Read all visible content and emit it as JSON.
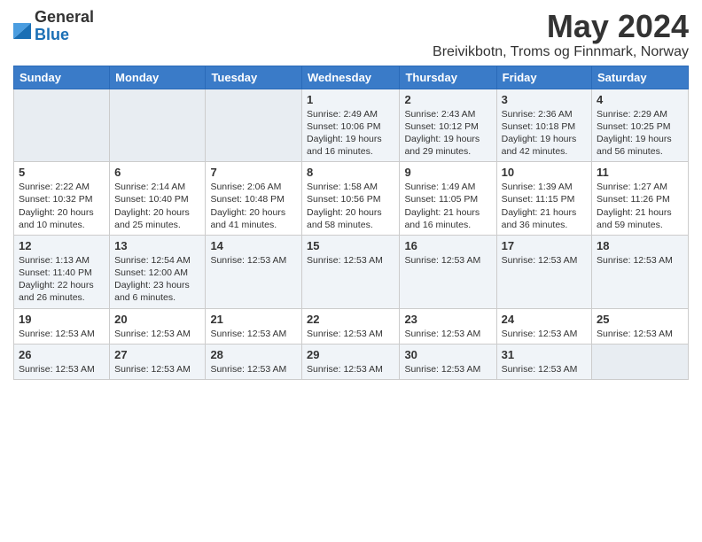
{
  "header": {
    "logo": {
      "general": "General",
      "blue": "Blue"
    },
    "month": "May 2024",
    "location": "Breivikbotn, Troms og Finnmark, Norway"
  },
  "days_of_week": [
    "Sunday",
    "Monday",
    "Tuesday",
    "Wednesday",
    "Thursday",
    "Friday",
    "Saturday"
  ],
  "weeks": [
    [
      {
        "day": "",
        "info": ""
      },
      {
        "day": "",
        "info": ""
      },
      {
        "day": "",
        "info": ""
      },
      {
        "day": "1",
        "info": "Sunrise: 2:49 AM\nSunset: 10:06 PM\nDaylight: 19 hours and 16 minutes."
      },
      {
        "day": "2",
        "info": "Sunrise: 2:43 AM\nSunset: 10:12 PM\nDaylight: 19 hours and 29 minutes."
      },
      {
        "day": "3",
        "info": "Sunrise: 2:36 AM\nSunset: 10:18 PM\nDaylight: 19 hours and 42 minutes."
      },
      {
        "day": "4",
        "info": "Sunrise: 2:29 AM\nSunset: 10:25 PM\nDaylight: 19 hours and 56 minutes."
      }
    ],
    [
      {
        "day": "5",
        "info": "Sunrise: 2:22 AM\nSunset: 10:32 PM\nDaylight: 20 hours and 10 minutes."
      },
      {
        "day": "6",
        "info": "Sunrise: 2:14 AM\nSunset: 10:40 PM\nDaylight: 20 hours and 25 minutes."
      },
      {
        "day": "7",
        "info": "Sunrise: 2:06 AM\nSunset: 10:48 PM\nDaylight: 20 hours and 41 minutes."
      },
      {
        "day": "8",
        "info": "Sunrise: 1:58 AM\nSunset: 10:56 PM\nDaylight: 20 hours and 58 minutes."
      },
      {
        "day": "9",
        "info": "Sunrise: 1:49 AM\nSunset: 11:05 PM\nDaylight: 21 hours and 16 minutes."
      },
      {
        "day": "10",
        "info": "Sunrise: 1:39 AM\nSunset: 11:15 PM\nDaylight: 21 hours and 36 minutes."
      },
      {
        "day": "11",
        "info": "Sunrise: 1:27 AM\nSunset: 11:26 PM\nDaylight: 21 hours and 59 minutes."
      }
    ],
    [
      {
        "day": "12",
        "info": "Sunrise: 1:13 AM\nSunset: 11:40 PM\nDaylight: 22 hours and 26 minutes."
      },
      {
        "day": "13",
        "info": "Sunrise: 12:54 AM\nSunset: 12:00 AM\nDaylight: 23 hours and 6 minutes."
      },
      {
        "day": "14",
        "info": "Sunrise: 12:53 AM"
      },
      {
        "day": "15",
        "info": "Sunrise: 12:53 AM"
      },
      {
        "day": "16",
        "info": "Sunrise: 12:53 AM"
      },
      {
        "day": "17",
        "info": "Sunrise: 12:53 AM"
      },
      {
        "day": "18",
        "info": "Sunrise: 12:53 AM"
      }
    ],
    [
      {
        "day": "19",
        "info": "Sunrise: 12:53 AM"
      },
      {
        "day": "20",
        "info": "Sunrise: 12:53 AM"
      },
      {
        "day": "21",
        "info": "Sunrise: 12:53 AM"
      },
      {
        "day": "22",
        "info": "Sunrise: 12:53 AM"
      },
      {
        "day": "23",
        "info": "Sunrise: 12:53 AM"
      },
      {
        "day": "24",
        "info": "Sunrise: 12:53 AM"
      },
      {
        "day": "25",
        "info": "Sunrise: 12:53 AM"
      }
    ],
    [
      {
        "day": "26",
        "info": "Sunrise: 12:53 AM"
      },
      {
        "day": "27",
        "info": "Sunrise: 12:53 AM"
      },
      {
        "day": "28",
        "info": "Sunrise: 12:53 AM"
      },
      {
        "day": "29",
        "info": "Sunrise: 12:53 AM"
      },
      {
        "day": "30",
        "info": "Sunrise: 12:53 AM"
      },
      {
        "day": "31",
        "info": "Sunrise: 12:53 AM"
      },
      {
        "day": "",
        "info": ""
      }
    ]
  ]
}
